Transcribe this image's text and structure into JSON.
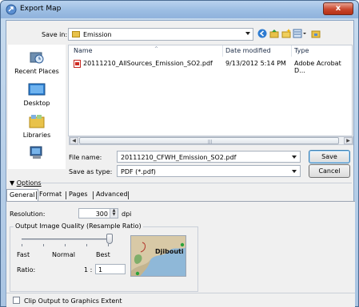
{
  "window": {
    "title": "Export Map",
    "close_label": "x"
  },
  "save_in": {
    "label": "Save in:",
    "folder": "Emission"
  },
  "places": [
    {
      "label": "Recent Places",
      "icon": "recent-places-icon"
    },
    {
      "label": "Desktop",
      "icon": "desktop-icon"
    },
    {
      "label": "Libraries",
      "icon": "libraries-icon"
    },
    {
      "label": "",
      "icon": "computer-icon"
    }
  ],
  "file_list": {
    "columns": [
      "Name",
      "Date modified",
      "Type"
    ],
    "rows": [
      {
        "name": "20111210_AllSources_Emission_SO2.pdf",
        "date": "9/13/2012 5:14 PM",
        "type": "Adobe Acrobat D..."
      }
    ]
  },
  "file_name": {
    "label": "File name:",
    "value": "20111210_CFWH_Emission_SO2.pdf"
  },
  "save_as_type": {
    "label": "Save as type:",
    "value": "PDF (*.pdf)"
  },
  "buttons": {
    "save": "Save",
    "cancel": "Cancel"
  },
  "options": {
    "label": "Options"
  },
  "tabs": [
    "General",
    "Format",
    "Pages",
    "Advanced"
  ],
  "general": {
    "resolution_label": "Resolution:",
    "resolution_value": "300",
    "resolution_unit": "dpi",
    "quality_group_title": "Output Image Quality (Resample Ratio)",
    "quality_labels": [
      "Fast",
      "Normal",
      "Best"
    ],
    "ratio_label": "Ratio:",
    "ratio_prefix": "1 :",
    "ratio_value": "1",
    "preview_label": "Djibouti"
  },
  "clip_output": {
    "label": "Clip Output to Graphics Extent",
    "checked": false
  },
  "colors": {
    "title_bar": "#9ebfe4",
    "close_button": "#c9462c",
    "map_land": "#d8c9a6",
    "map_water": "#8fb8d8"
  }
}
